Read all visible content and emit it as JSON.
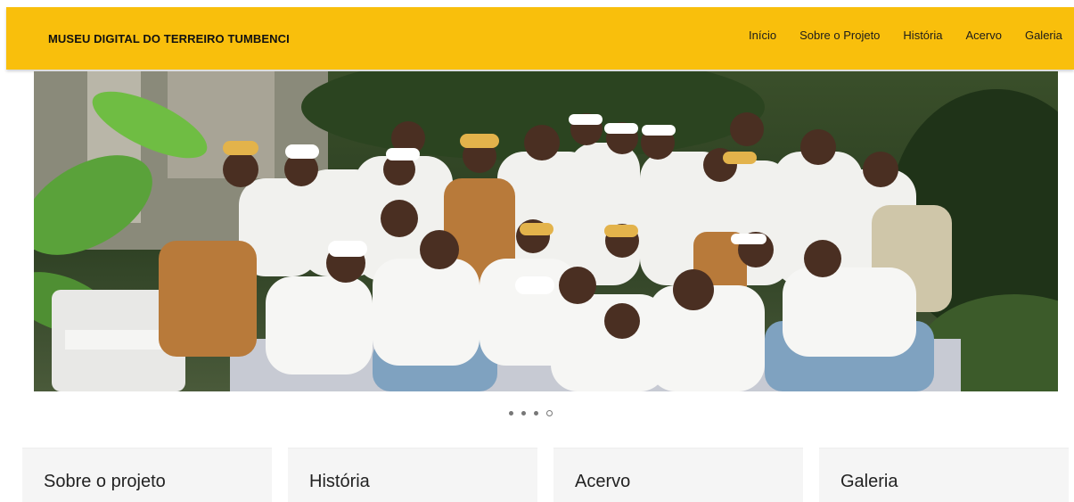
{
  "header": {
    "brand": "MUSEU DIGITAL DO TERREIRO TUMBENCI",
    "nav": [
      "Início",
      "Sobre o Projeto",
      "História",
      "Acervo",
      "Galeria"
    ]
  },
  "carousel": {
    "slide_count": 4,
    "active_index": 3
  },
  "cards": [
    {
      "title": "Sobre o projeto"
    },
    {
      "title": "História"
    },
    {
      "title": "Acervo"
    },
    {
      "title": "Galeria"
    }
  ],
  "colors": {
    "navbar": "#f9bf0c",
    "card_bg": "#f5f5f5"
  }
}
